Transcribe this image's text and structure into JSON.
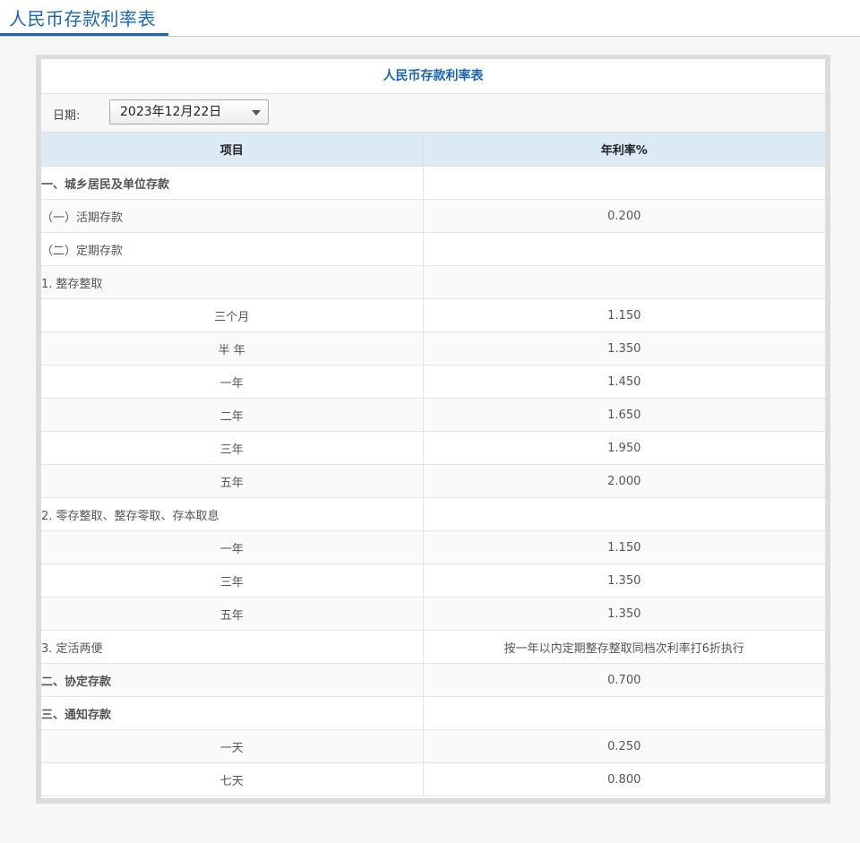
{
  "page": {
    "title": "人民币存款利率表"
  },
  "table": {
    "title": "人民币存款利率表",
    "date_label": "日期:",
    "date_value": "2023年12月22日",
    "headers": {
      "item": "项目",
      "rate": "年利率%"
    },
    "rows": [
      {
        "label": "一、城乡居民及单位存款",
        "rate": "",
        "level": 1
      },
      {
        "label": "（一）活期存款",
        "rate": "0.200",
        "level": 2
      },
      {
        "label": "（二）定期存款",
        "rate": "",
        "level": 2
      },
      {
        "label": "1. 整存整取",
        "rate": "",
        "level": 3
      },
      {
        "label": "三个月",
        "rate": "1.150",
        "level": 4
      },
      {
        "label": "半 年",
        "rate": "1.350",
        "level": 4
      },
      {
        "label": "一年",
        "rate": "1.450",
        "level": 4
      },
      {
        "label": "二年",
        "rate": "1.650",
        "level": 4
      },
      {
        "label": "三年",
        "rate": "1.950",
        "level": 4
      },
      {
        "label": "五年",
        "rate": "2.000",
        "level": 4
      },
      {
        "label": "2. 零存整取、整存零取、存本取息",
        "rate": "",
        "level": 3
      },
      {
        "label": "一年",
        "rate": "1.150",
        "level": 4
      },
      {
        "label": "三年",
        "rate": "1.350",
        "level": 4
      },
      {
        "label": "五年",
        "rate": "1.350",
        "level": 4
      },
      {
        "label": "3. 定活两便",
        "rate": "按一年以内定期整存整取同档次利率打6折执行",
        "level": 3
      },
      {
        "label": "二、协定存款",
        "rate": "0.700",
        "level": 1
      },
      {
        "label": "三、通知存款",
        "rate": "",
        "level": 1
      },
      {
        "label": "一天",
        "rate": "0.250",
        "level": 4
      },
      {
        "label": "七天",
        "rate": "0.800",
        "level": 4
      }
    ]
  },
  "colors": {
    "accent": "#1a66b3",
    "header_bg": "#dceaf6"
  },
  "icons": {
    "date_dropdown": "chevron-down-icon"
  }
}
